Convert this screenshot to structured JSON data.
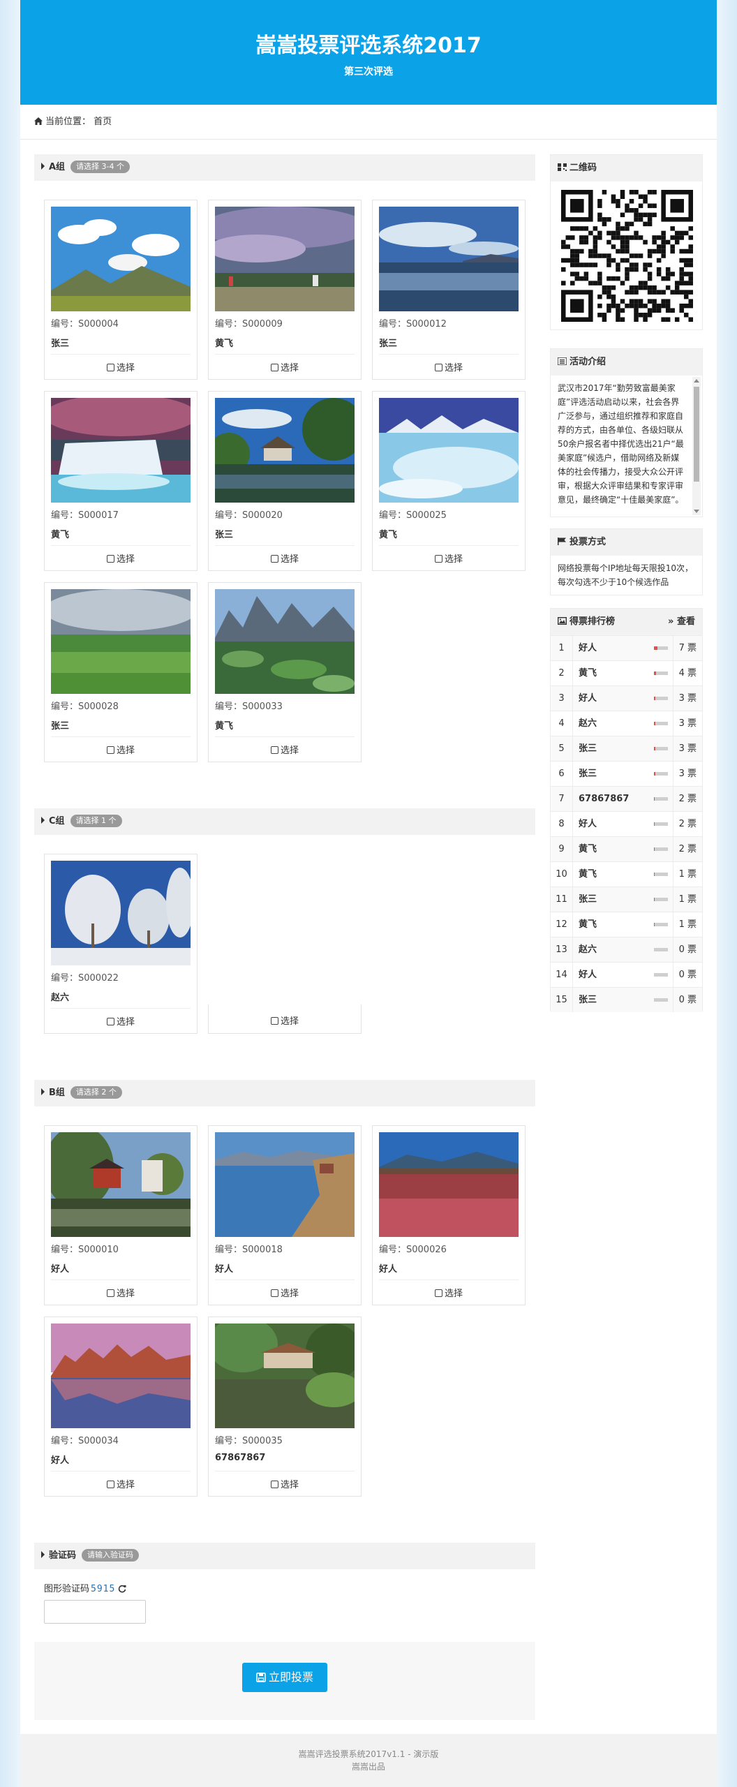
{
  "header": {
    "title": "嵩嵩投票评选系统2017",
    "subtitle": "第三次评选"
  },
  "breadcrumb": {
    "label": "当前位置：",
    "current": "首页"
  },
  "select_label": "选择",
  "groups": [
    {
      "title": "A组",
      "badge": "请选择 3-4 个",
      "items": [
        {
          "code": "编号：S000004",
          "name": "张三",
          "image": "mountain-meadow"
        },
        {
          "code": "编号：S000009",
          "name": "黄飞",
          "image": "stormy-lake"
        },
        {
          "code": "编号：S000012",
          "name": "张三",
          "image": "calm-sea"
        },
        {
          "code": "编号：S000017",
          "name": "黄飞",
          "image": "waterfall"
        },
        {
          "code": "编号：S000020",
          "name": "张三",
          "image": "park-pond"
        },
        {
          "code": "编号：S000025",
          "name": "黄飞",
          "image": "icy-shore"
        },
        {
          "code": "编号：S000028",
          "name": "张三",
          "image": "wheat-field"
        },
        {
          "code": "编号：S000033",
          "name": "黄飞",
          "image": "karst-lotus"
        }
      ]
    },
    {
      "title": "C组",
      "badge": "请选择 1 个",
      "items": [
        {
          "code": "编号：S000022",
          "name": "赵六",
          "image": "frosted-trees"
        }
      ]
    },
    {
      "title": "B组",
      "badge": "请选择 2 个",
      "items": [
        {
          "code": "编号：S000010",
          "name": "好人",
          "image": "willow-pavilion"
        },
        {
          "code": "编号：S000018",
          "name": "好人",
          "image": "blue-lake"
        },
        {
          "code": "编号：S000026",
          "name": "好人",
          "image": "flower-field"
        },
        {
          "code": "编号：S000034",
          "name": "好人",
          "image": "red-rocks"
        },
        {
          "code": "编号：S000035",
          "name": "67867867",
          "image": "jungle-pond"
        }
      ]
    }
  ],
  "captcha": {
    "title": "验证码",
    "badge": "请输入验证码",
    "label": "图形验证码",
    "code": "5915",
    "input_value": ""
  },
  "submit_label": "立即投票",
  "footer": {
    "line1": "嵩嵩评选投票系统2017v1.1 - 演示版",
    "line2": "嵩嵩出品"
  },
  "sidebar": {
    "qr_title": "二维码",
    "intro_title": "活动介绍",
    "intro_text": "武汉市2017年“勤劳致富最美家庭”评选活动启动以来，社会各界广泛参与，通过组织推荐和家庭自荐的方式，由各单位、各级妇联从50余户报名者中择优选出21户“最美家庭”候选户，借助网络及新媒体的社会传播力，接受大众公开评审，根据大众评审结果和专家评审意见，最终确定“十佳最美家庭”。",
    "method_title": "投票方式",
    "method_text": "网络投票每个IP地址每天限投10次，每次勾选不少于10个候选作品",
    "rank_title": "得票排行榜",
    "rank_view": "查看",
    "ranking": [
      {
        "rank": "1",
        "name": "好人",
        "votes": "7 票",
        "share": 0.25
      },
      {
        "rank": "2",
        "name": "黄飞",
        "votes": "4 票",
        "share": 0.15
      },
      {
        "rank": "3",
        "name": "好人",
        "votes": "3 票",
        "share": 0.11
      },
      {
        "rank": "4",
        "name": "赵六",
        "votes": "3 票",
        "share": 0.11
      },
      {
        "rank": "5",
        "name": "张三",
        "votes": "3 票",
        "share": 0.11
      },
      {
        "rank": "6",
        "name": "张三",
        "votes": "3 票",
        "share": 0.11
      },
      {
        "rank": "7",
        "name": "67867867",
        "votes": "2 票",
        "share": 0.07
      },
      {
        "rank": "8",
        "name": "好人",
        "votes": "2 票",
        "share": 0.07
      },
      {
        "rank": "9",
        "name": "黄飞",
        "votes": "2 票",
        "share": 0.07
      },
      {
        "rank": "10",
        "name": "黄飞",
        "votes": "1 票",
        "share": 0.04
      },
      {
        "rank": "11",
        "name": "张三",
        "votes": "1 票",
        "share": 0.04
      },
      {
        "rank": "12",
        "name": "黄飞",
        "votes": "1 票",
        "share": 0.04
      },
      {
        "rank": "13",
        "name": "赵六",
        "votes": "0 票",
        "share": 0
      },
      {
        "rank": "14",
        "name": "好人",
        "votes": "0 票",
        "share": 0
      },
      {
        "rank": "15",
        "name": "张三",
        "votes": "0 票",
        "share": 0
      }
    ]
  },
  "colors": {
    "brand": "#0ca2e8",
    "badge": "#999999",
    "bar": "#d9534f"
  }
}
